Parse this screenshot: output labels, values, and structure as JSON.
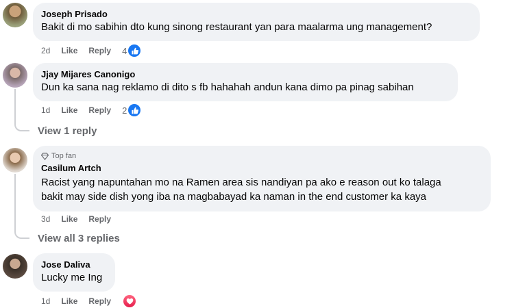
{
  "comments": [
    {
      "author": "Joseph Prisado",
      "text": "Bakit di mo sabihin dto kung sinong restaurant yan para maalarma ung management?",
      "time": "2d",
      "like": "Like",
      "reply": "Reply",
      "reaction_count": "4",
      "reaction": "like-icon"
    },
    {
      "author": "Jjay Mijares Canonigo",
      "text": "Dun ka sana nag reklamo di dito s fb hahahah andun kana dimo pa pinag sabihan",
      "time": "1d",
      "like": "Like",
      "reply": "Reply",
      "reaction_count": "2",
      "reaction": "like-icon",
      "view_replies": "View 1 reply"
    },
    {
      "badge": "Top fan",
      "author": "Casilum Artch",
      "text_line1": "Racist yang napuntahan mo na Ramen area sis nandiyan pa ako e reason out ko talaga",
      "text_line2": "bakit may side dish yong iba na magbabayad ka naman in the end customer ka kaya",
      "time": "3d",
      "like": "Like",
      "reply": "Reply",
      "view_replies": "View all 3 replies"
    },
    {
      "author": "Jose Daliva",
      "text": "Lucky me Ing",
      "time": "1d",
      "like": "Like",
      "reply": "Reply",
      "reaction": "love-icon"
    }
  ],
  "colors": {
    "bubble": "#f0f2f5",
    "meta": "#65676b",
    "like_blue": "#1877f2",
    "love_red": "#e61e4d"
  }
}
